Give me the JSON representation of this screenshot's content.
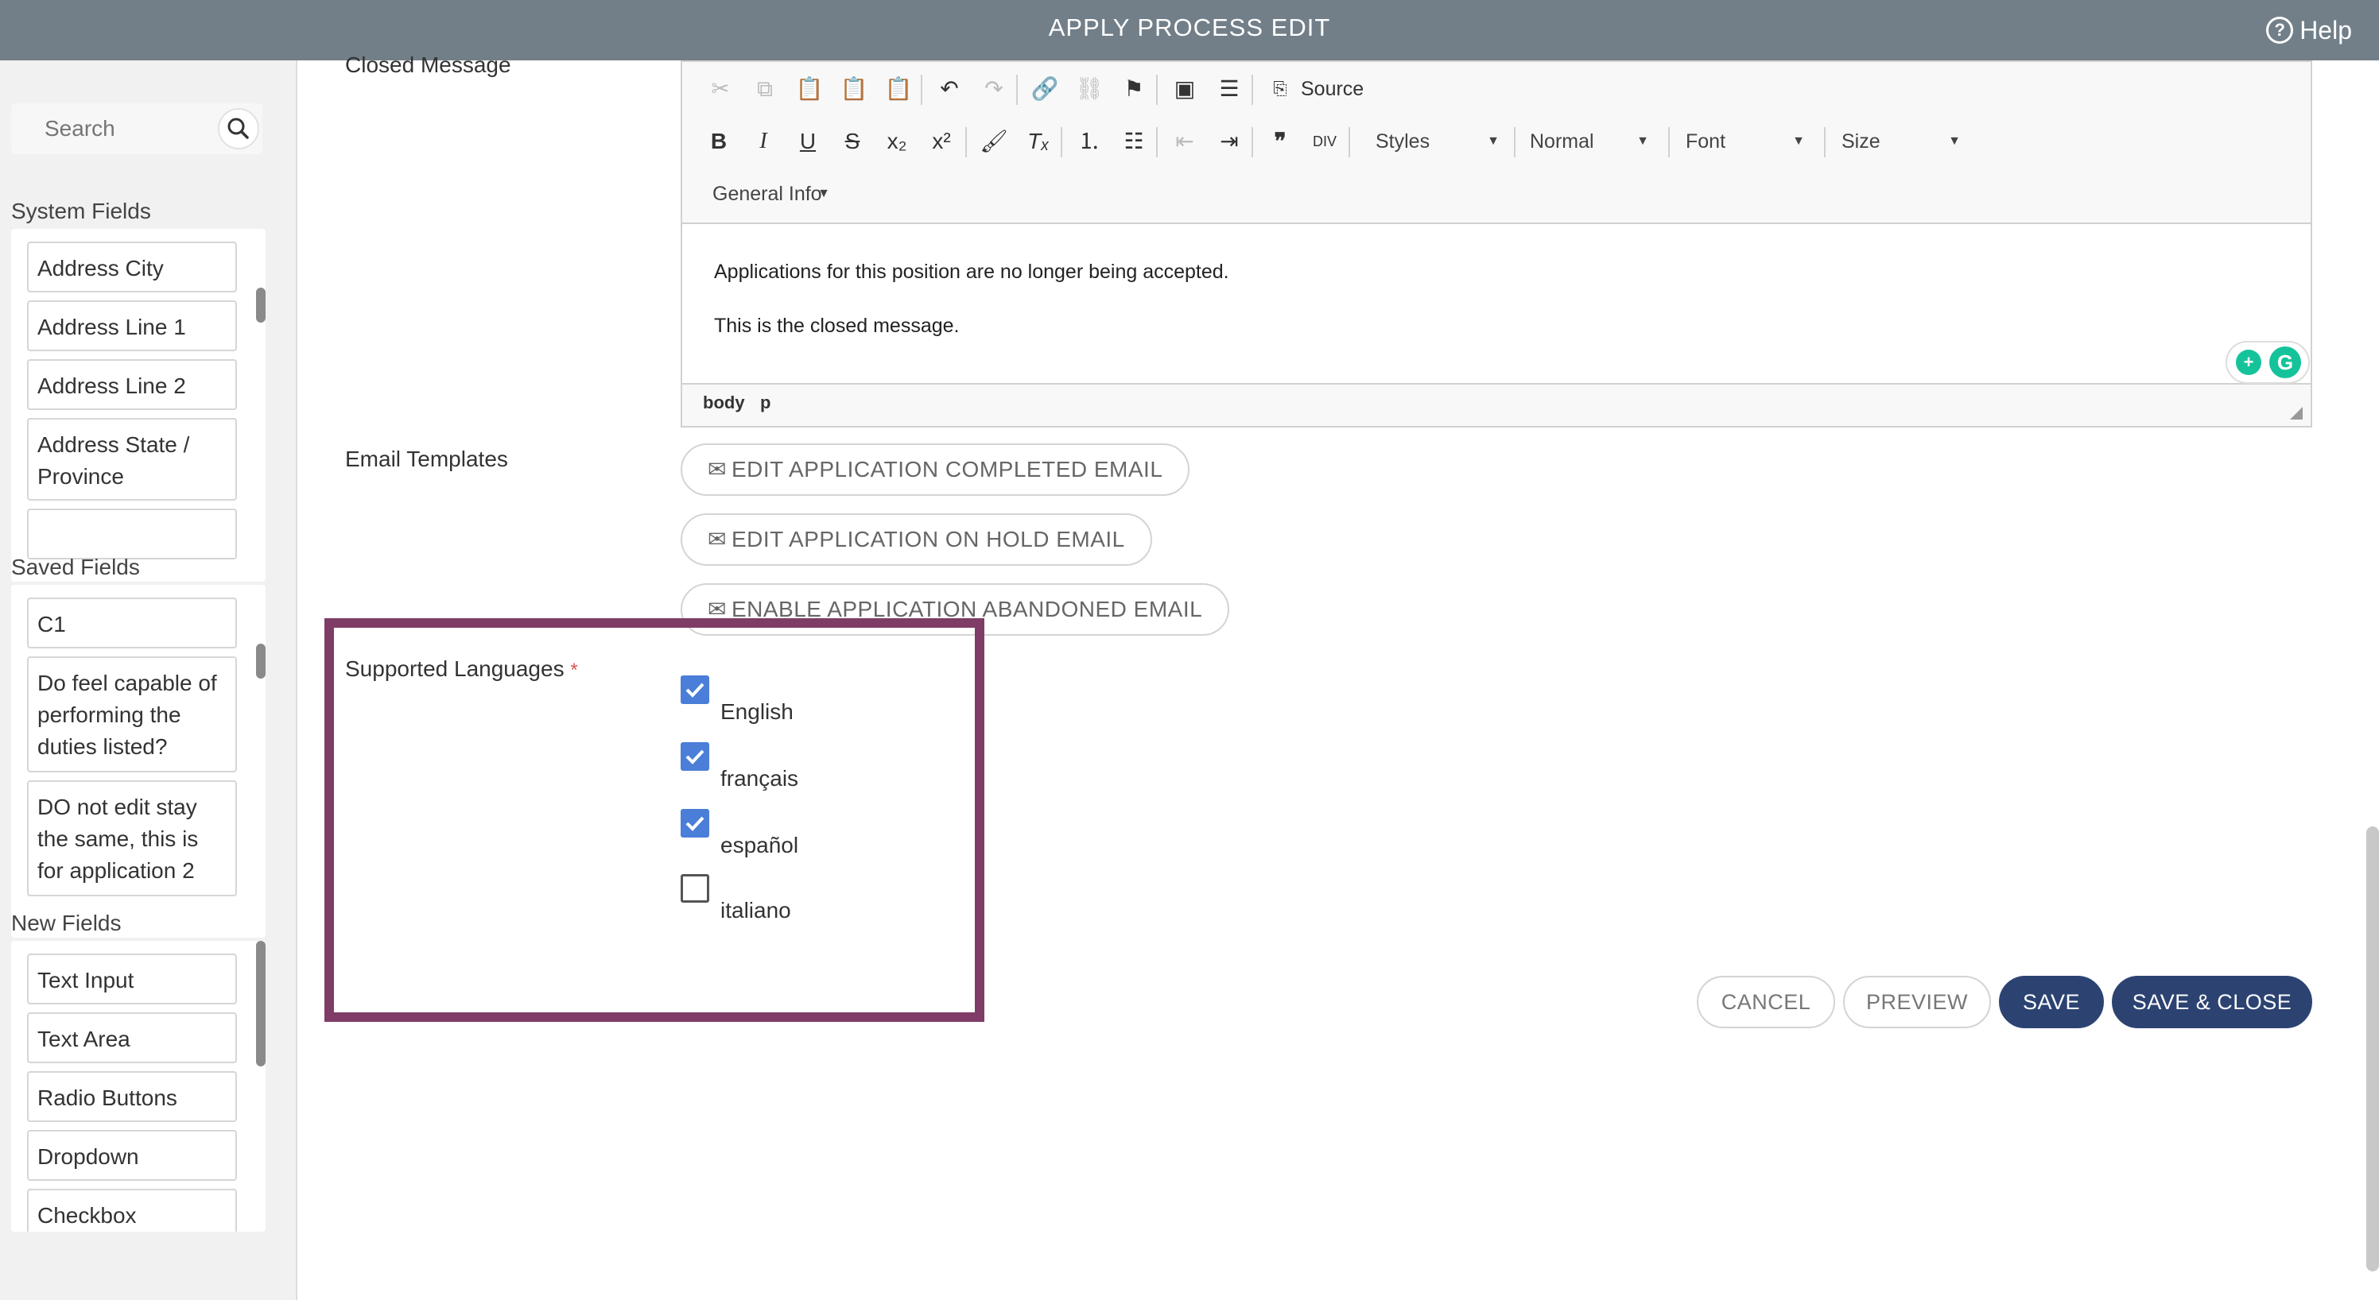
{
  "header": {
    "title": "APPLY PROCESS EDIT",
    "help_label": "Help"
  },
  "sidebar": {
    "search_placeholder": "Search",
    "system_fields": {
      "title": "System Fields",
      "items": [
        "Address City",
        "Address Line 1",
        "Address Line 2",
        "Address State / Province"
      ]
    },
    "saved_fields": {
      "title": "Saved Fields",
      "items": [
        "C1",
        "Do feel capable of performing the duties listed?",
        "DO not edit stay the same, this is for application 2"
      ]
    },
    "new_fields": {
      "title": "New Fields",
      "items": [
        "Text Input",
        "Text Area",
        "Radio Buttons",
        "Dropdown",
        "Checkbox"
      ]
    }
  },
  "closed_message": {
    "label": "Closed Message",
    "toolbar": {
      "source_label": "Source",
      "styles_label": "Styles",
      "format_label": "Normal",
      "font_label": "Font",
      "size_label": "Size",
      "general_info_label": "General Info"
    },
    "body_lines": [
      "Applications for this position are no longer being accepted.",
      "This is the closed message."
    ],
    "path": [
      "body",
      "p"
    ]
  },
  "email_templates": {
    "label": "Email Templates",
    "buttons": [
      "EDIT APPLICATION COMPLETED EMAIL",
      "EDIT APPLICATION ON HOLD EMAIL",
      "ENABLE APPLICATION ABANDONED EMAIL"
    ]
  },
  "supported_languages": {
    "label": "Supported Languages",
    "required_mark": "*",
    "options": [
      {
        "label": "English",
        "checked": true
      },
      {
        "label": "français",
        "checked": true
      },
      {
        "label": "español",
        "checked": true
      },
      {
        "label": "italiano",
        "checked": false
      }
    ]
  },
  "actions": {
    "cancel": "CANCEL",
    "preview": "PREVIEW",
    "save": "SAVE",
    "save_close": "SAVE & CLOSE"
  },
  "colors": {
    "header_bg": "#727f88",
    "primary": "#2c4372",
    "checkbox": "#4a7ed8",
    "highlight": "#7e3c66"
  }
}
